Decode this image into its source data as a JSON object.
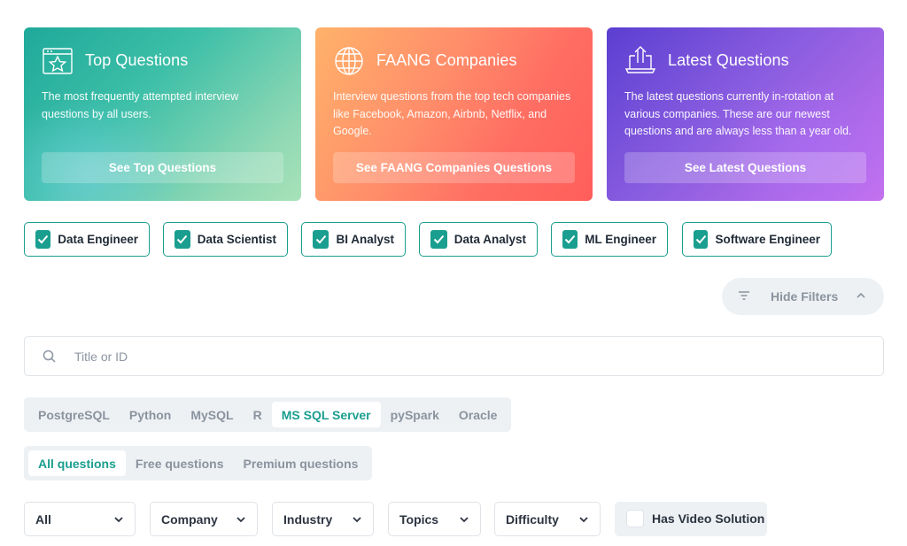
{
  "cards": [
    {
      "id": "top",
      "icon": "star-window-icon",
      "title": "Top Questions",
      "description": "The most frequently attempted interview questions by all users.",
      "button": "See Top Questions"
    },
    {
      "id": "faang",
      "icon": "globe-icon",
      "title": "FAANG Companies",
      "description": "Interview questions from the top tech companies like Facebook, Amazon, Airbnb, Netflix, and Google.",
      "button": "See FAANG Companies Questions"
    },
    {
      "id": "latest",
      "icon": "laptop-upload-icon",
      "title": "Latest Questions",
      "description": "The latest questions currently in-rotation at various companies. These are our newest questions and are always less than a year old.",
      "button": "See Latest Questions"
    }
  ],
  "roles": [
    {
      "label": "Data Engineer",
      "checked": true
    },
    {
      "label": "Data Scientist",
      "checked": true
    },
    {
      "label": "BI Analyst",
      "checked": true
    },
    {
      "label": "Data Analyst",
      "checked": true
    },
    {
      "label": "ML Engineer",
      "checked": true
    },
    {
      "label": "Software Engineer",
      "checked": true
    }
  ],
  "hide_filters": {
    "label": "Hide Filters",
    "icon": "filter-icon",
    "chevron": "chevron-up-icon"
  },
  "search": {
    "placeholder": "Title or ID",
    "value": "",
    "icon": "search-icon"
  },
  "languages": {
    "options": [
      "PostgreSQL",
      "Python",
      "MySQL",
      "R",
      "MS SQL Server",
      "pySpark",
      "Oracle"
    ],
    "selected": "MS SQL Server"
  },
  "access": {
    "options": [
      "All questions",
      "Free questions",
      "Premium questions"
    ],
    "selected": "All questions"
  },
  "dropdowns": [
    {
      "label": "All"
    },
    {
      "label": "Company"
    },
    {
      "label": "Industry"
    },
    {
      "label": "Topics"
    },
    {
      "label": "Difficulty"
    }
  ],
  "video_filter": {
    "label": "Has Video Solution",
    "checked": false
  },
  "colors": {
    "accent": "#1a9e8f",
    "muted_text": "#8a939e",
    "panel_bg": "#eef1f4",
    "card_top": "#3dbfa8",
    "card_faang": "#ff7a64",
    "card_latest": "#8a5de0"
  }
}
